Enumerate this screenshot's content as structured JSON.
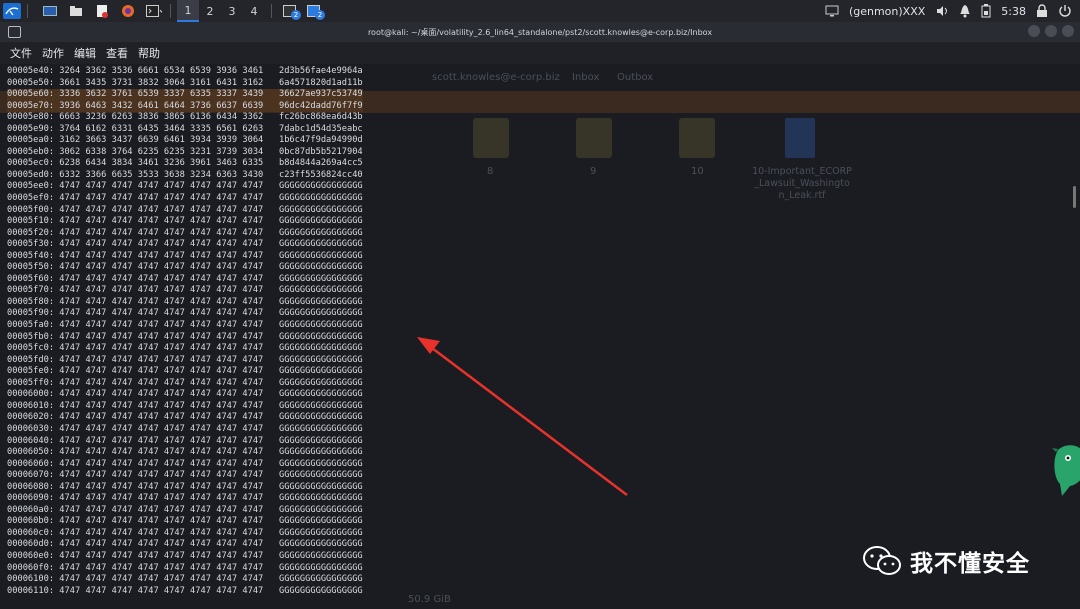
{
  "panel": {
    "workspaces": [
      "1",
      "2",
      "3",
      "4"
    ],
    "active_workspace": "1",
    "task_badges": [
      "2",
      "2"
    ],
    "user": "(genmon)XXX",
    "time": "5:38"
  },
  "window": {
    "title": "root@kali: ~/桌面/volatility_2.6_lin64_standalone/pst2/scott.knowles@e-corp.biz/Inbox"
  },
  "menu": [
    "文件",
    "动作",
    "编辑",
    "查看",
    "帮助"
  ],
  "background_fm": {
    "breadcrumbs": [
      "scott.knowles@e-corp.biz",
      "Inbox",
      "Outbox"
    ],
    "files": [
      "8",
      "9",
      "10"
    ],
    "doc_name": "10-Important_ECORP_Lawsuit_Washington_Leak.rtf",
    "status": "50.9 GiB"
  },
  "dump_rows": [
    "00005e40: 3264 3362 3536 6661 6534 6539 3936 3461   2d3b56fae4e9964a",
    "00005e50: 3661 3435 3731 3832 3064 3161 6431 3162   6a4571820d1ad11b",
    "00005e60: 3336 3632 3761 6539 3337 6335 3337 3439   36627ae937c53749",
    "00005e70: 3936 6463 3432 6461 6464 3736 6637 6639   96dc42dadd76f7f9",
    "00005e80: 6663 3236 6263 3836 3865 6136 6434 3362   fc26bc868ea6d43b",
    "00005e90: 3764 6162 6331 6435 3464 3335 6561 6263   7dabc1d54d35eabc",
    "00005ea0: 3162 3663 3437 6639 6461 3934 3939 3064   1b6c47f9da94990d",
    "00005eb0: 3062 6338 3764 6235 6235 3231 3739 3034   0bc87db5b5217904",
    "00005ec0: 6238 6434 3834 3461 3236 3961 3463 6335   b8d4844a269a4cc5",
    "00005ed0: 6332 3366 6635 3533 3638 3234 6363 3430   c23ff5536824cc40",
    "00005ee0: 4747 4747 4747 4747 4747 4747 4747 4747   GGGGGGGGGGGGGGGG",
    "00005ef0: 4747 4747 4747 4747 4747 4747 4747 4747   GGGGGGGGGGGGGGGG",
    "00005f00: 4747 4747 4747 4747 4747 4747 4747 4747   GGGGGGGGGGGGGGGG",
    "00005f10: 4747 4747 4747 4747 4747 4747 4747 4747   GGGGGGGGGGGGGGGG",
    "00005f20: 4747 4747 4747 4747 4747 4747 4747 4747   GGGGGGGGGGGGGGGG",
    "00005f30: 4747 4747 4747 4747 4747 4747 4747 4747   GGGGGGGGGGGGGGGG",
    "00005f40: 4747 4747 4747 4747 4747 4747 4747 4747   GGGGGGGGGGGGGGGG",
    "00005f50: 4747 4747 4747 4747 4747 4747 4747 4747   GGGGGGGGGGGGGGGG",
    "00005f60: 4747 4747 4747 4747 4747 4747 4747 4747   GGGGGGGGGGGGGGGG",
    "00005f70: 4747 4747 4747 4747 4747 4747 4747 4747   GGGGGGGGGGGGGGGG",
    "00005f80: 4747 4747 4747 4747 4747 4747 4747 4747   GGGGGGGGGGGGGGGG",
    "00005f90: 4747 4747 4747 4747 4747 4747 4747 4747   GGGGGGGGGGGGGGGG",
    "00005fa0: 4747 4747 4747 4747 4747 4747 4747 4747   GGGGGGGGGGGGGGGG",
    "00005fb0: 4747 4747 4747 4747 4747 4747 4747 4747   GGGGGGGGGGGGGGGG",
    "00005fc0: 4747 4747 4747 4747 4747 4747 4747 4747   GGGGGGGGGGGGGGGG",
    "00005fd0: 4747 4747 4747 4747 4747 4747 4747 4747   GGGGGGGGGGGGGGGG",
    "00005fe0: 4747 4747 4747 4747 4747 4747 4747 4747   GGGGGGGGGGGGGGGG",
    "00005ff0: 4747 4747 4747 4747 4747 4747 4747 4747   GGGGGGGGGGGGGGGG",
    "00006000: 4747 4747 4747 4747 4747 4747 4747 4747   GGGGGGGGGGGGGGGG",
    "00006010: 4747 4747 4747 4747 4747 4747 4747 4747   GGGGGGGGGGGGGGGG",
    "00006020: 4747 4747 4747 4747 4747 4747 4747 4747   GGGGGGGGGGGGGGGG",
    "00006030: 4747 4747 4747 4747 4747 4747 4747 4747   GGGGGGGGGGGGGGGG",
    "00006040: 4747 4747 4747 4747 4747 4747 4747 4747   GGGGGGGGGGGGGGGG",
    "00006050: 4747 4747 4747 4747 4747 4747 4747 4747   GGGGGGGGGGGGGGGG",
    "00006060: 4747 4747 4747 4747 4747 4747 4747 4747   GGGGGGGGGGGGGGGG",
    "00006070: 4747 4747 4747 4747 4747 4747 4747 4747   GGGGGGGGGGGGGGGG",
    "00006080: 4747 4747 4747 4747 4747 4747 4747 4747   GGGGGGGGGGGGGGGG",
    "00006090: 4747 4747 4747 4747 4747 4747 4747 4747   GGGGGGGGGGGGGGGG",
    "000060a0: 4747 4747 4747 4747 4747 4747 4747 4747   GGGGGGGGGGGGGGGG",
    "000060b0: 4747 4747 4747 4747 4747 4747 4747 4747   GGGGGGGGGGGGGGGG",
    "000060c0: 4747 4747 4747 4747 4747 4747 4747 4747   GGGGGGGGGGGGGGGG",
    "000060d0: 4747 4747 4747 4747 4747 4747 4747 4747   GGGGGGGGGGGGGGGG",
    "000060e0: 4747 4747 4747 4747 4747 4747 4747 4747   GGGGGGGGGGGGGGGG",
    "000060f0: 4747 4747 4747 4747 4747 4747 4747 4747   GGGGGGGGGGGGGGGG",
    "00006100: 4747 4747 4747 4747 4747 4747 4747 4747   GGGGGGGGGGGGGGGG",
    "00006110: 4747 4747 4747 4747 4747 4747 4747 4747   GGGGGGGGGGGGGGGG"
  ],
  "watermark": "我不懂安全",
  "colors": {
    "arrow": "#e8322b",
    "accent": "#2d7ae0",
    "highlight": "#4c3320"
  }
}
